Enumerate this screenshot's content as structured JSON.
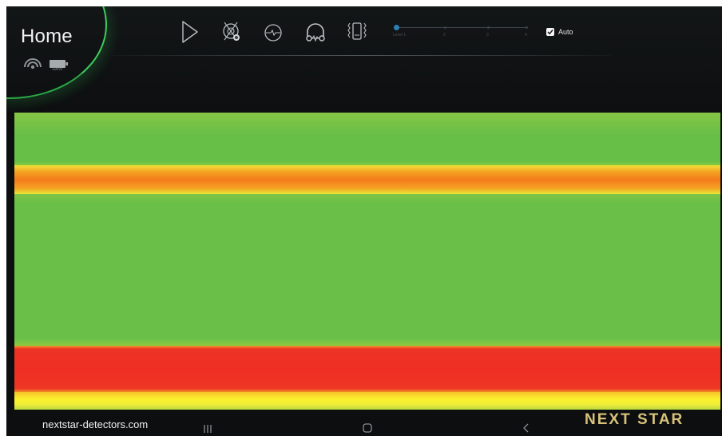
{
  "header": {
    "title": "Home",
    "battery_percent": "100%",
    "toolbar": [
      {
        "name": "play",
        "icon": "play-icon"
      },
      {
        "name": "ground-balance",
        "icon": "ground-balance-icon"
      },
      {
        "name": "signal",
        "icon": "signal-line-icon"
      },
      {
        "name": "headphones",
        "icon": "headphones-icon"
      },
      {
        "name": "vibration",
        "icon": "vibration-phone-icon"
      }
    ],
    "sensitivity_slider": {
      "selected_label": "Level 1",
      "tick_labels": [
        "2",
        "3",
        "4"
      ],
      "value_fraction": 0.0
    },
    "auto": {
      "label": "Auto",
      "checked": true
    }
  },
  "heatmap": {
    "bands_top_to_bottom": [
      "green",
      "orange",
      "green",
      "red",
      "yellow"
    ],
    "colors": {
      "green": "#6abf48",
      "orange": "#f47b1c",
      "red": "#ef2e24",
      "yellow": "#fbf12c"
    }
  },
  "footer": {
    "website": "nextstar-detectors.com",
    "brand": "NEXT STAR"
  },
  "nav": [
    "recent-apps-icon",
    "home-icon",
    "back-icon"
  ]
}
